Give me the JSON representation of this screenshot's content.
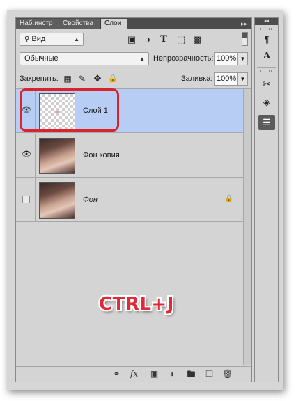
{
  "tabs": [
    {
      "label": "Наб.инстр"
    },
    {
      "label": "Свойства"
    },
    {
      "label": "Слои"
    }
  ],
  "tab_menu_icon": "double-chevron-right",
  "filter": {
    "label": "Вид"
  },
  "filter_icons": [
    "image-filter-icon",
    "adjustment-filter-icon",
    "text-filter-icon",
    "shape-filter-icon",
    "smart-object-filter-icon"
  ],
  "blend_mode": {
    "value": "Обычные"
  },
  "opacity": {
    "label": "Непрозрачность:",
    "value": "100%"
  },
  "lock": {
    "label": "Закрепить:"
  },
  "fill": {
    "label": "Заливка:",
    "value": "100%"
  },
  "layers": [
    {
      "name": "Слой 1",
      "visible": true,
      "selected": true,
      "thumb": "transparent"
    },
    {
      "name": "Фон копия",
      "visible": true,
      "selected": false,
      "thumb": "photo"
    },
    {
      "name": "Фон",
      "visible": false,
      "selected": false,
      "thumb": "photo",
      "locked": true
    }
  ],
  "annotation": {
    "text": "CTRL+J",
    "color": "#e02a35"
  },
  "highlight_color": "#d8242e",
  "selected_layer_color": "#b7cdf3",
  "bottom_icons": [
    "link-icon",
    "fx-icon",
    "mask-icon",
    "adjustment-icon",
    "folder-icon",
    "new-layer-icon",
    "trash-icon"
  ]
}
